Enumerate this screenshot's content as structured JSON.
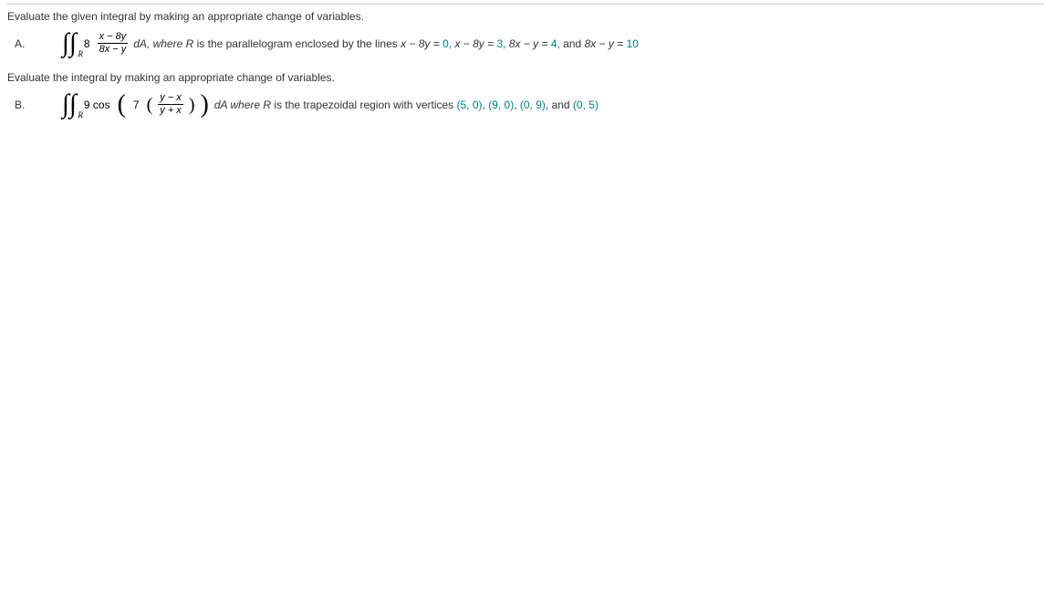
{
  "sectionA": {
    "prompt": "Evaluate the given integral by making an appropriate change of variables.",
    "label": "A.",
    "coef": "8",
    "frac_num": "x − 8y",
    "frac_den": "8x − y",
    "sub": "R",
    "desc_lead": "dA,  where ",
    "desc_Rvar": "R",
    "desc_mid": " is the parallelogram enclosed by the lines  ",
    "eq1": "x − 8y = ",
    "eq1v": "0,",
    "eq2": "   x − 8y = ",
    "eq2v": "3,",
    "eq3": "   8x − y = ",
    "eq3v": "4,",
    "and": "  and  ",
    "eq4": "8x − y = ",
    "eq4v": "10"
  },
  "sectionB": {
    "prompt": "Evaluate the integral by making an appropriate change of variables.",
    "label": "B.",
    "coef": "9 cos",
    "innerCoef": "7",
    "frac_num": "y − x",
    "frac_den": "y + x",
    "sub": "R",
    "desc_lead": "dA  where ",
    "desc_Rvar": "R",
    "desc_mid": " is the trapezoidal region with vertices ",
    "v1": "(5, 0)",
    "c": ", ",
    "v2": "(9, 0)",
    "v3": "(0, 9)",
    "and": ", and ",
    "v4": "(0, 5)"
  }
}
